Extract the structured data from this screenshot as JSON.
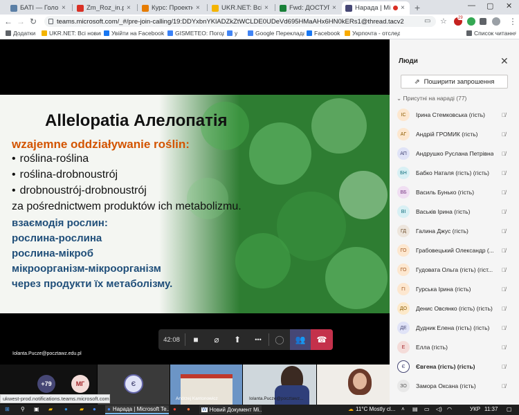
{
  "browser": {
    "tabs": [
      {
        "title": "БАТІ — Головні пр",
        "color": "#5b7fa6"
      },
      {
        "title": "Zm_Roz_in.pdf",
        "color": "#d93025"
      },
      {
        "title": "Курс: Проектний п",
        "color": "#e67c00"
      },
      {
        "title": "UKR.NET: Всі нови",
        "color": "#f4b400"
      },
      {
        "title": "Fwd: ДОСТУП ДО",
        "color": "#188038"
      },
      {
        "title": "Нарада | Micro",
        "color": "#464775"
      }
    ],
    "new_tab": "+",
    "url": "teams.microsoft.com/_#/pre-join-calling/19:DDYxbnYKlADZkZtWCLDE0UDeVd695HMaAHx6HN0kERs1@thread.tacv2",
    "bookmarks": [
      {
        "label": "Додатки",
        "color": "#5f6368"
      },
      {
        "label": "UKR.NET: Всі новин...",
        "color": "#f4b400"
      },
      {
        "label": "Увійти на Facebook...",
        "color": "#1877f2"
      },
      {
        "label": "GISMETEO: Погода...",
        "color": "#3b82f6"
      },
      {
        "label": "y",
        "color": "#4285f4"
      },
      {
        "label": "Google Перекладач",
        "color": "#4285f4"
      },
      {
        "label": "Facebook",
        "color": "#1877f2"
      },
      {
        "label": "Укрпочта - отслед...",
        "color": "#f9ab00"
      }
    ],
    "reading_list": "Список читання",
    "profile_badge": "29"
  },
  "slide": {
    "title": "Allelopatia Алелопатія",
    "subtitle": "wzajemne oddziaływanie roślin:",
    "bullets": [
      "roślina-roślina",
      "roślina-drobnoustrój",
      "drobnoustrój-drobnoustrój"
    ],
    "line_pl": "za pośrednictwem produktów ich metabolizmu.",
    "lines_ua": [
      "взаємодія рослин:",
      "рослина-рослина",
      "рослина-мікроб",
      "мікроорганізм-мікроорганізм",
      "через продукти їх метаболізму."
    ]
  },
  "presenter_email": "Iolanta.Pucze@pocztawz.edu.pl",
  "call": {
    "timer": "42:08",
    "more": "•••"
  },
  "strip": {
    "more_count": "+79",
    "avatar_mg": "МГ",
    "avatar_e": "Є",
    "tile1_label": "Andrzej Kantonowicz",
    "tile2_label": "Iolanta.Pucze@pocztawz..."
  },
  "status_bar": "ukwest-prod.notifications.teams.microsoft.com...",
  "panel": {
    "title": "Люди",
    "share_label": "Поширити запрошення",
    "section": "Присутні на нараді (77)",
    "people": [
      {
        "initials": "ІС",
        "name": "Ірина Стемковська (гість)",
        "bg": "#fde7cf",
        "fg": "#8a5a00",
        "bold": false
      },
      {
        "initials": "АГ",
        "name": "Андрій ГРОМИК (гість)",
        "bg": "#fde7cf",
        "fg": "#8a5a00",
        "bold": false
      },
      {
        "initials": "АП",
        "name": "Андрушко Руслана Петрівна",
        "bg": "#e0e3f7",
        "fg": "#464775",
        "bold": false
      },
      {
        "initials": "БН",
        "name": "Бабко Наталя (гість) (гість)",
        "bg": "#d8f0f4",
        "fg": "#0b6a79",
        "bold": false
      },
      {
        "initials": "ВБ",
        "name": "Василь Бунько (гість)",
        "bg": "#f0def2",
        "fg": "#7a3b85",
        "bold": false
      },
      {
        "initials": "ВІ",
        "name": "Васьків Ірина (гість)",
        "bg": "#d8f0f4",
        "fg": "#0b6a79",
        "bold": false
      },
      {
        "initials": "ГД",
        "name": "Галина Джус (гість)",
        "bg": "#ede5dc",
        "fg": "#6b4c2a",
        "bold": false
      },
      {
        "initials": "ГО",
        "name": "Грабовецький Олександр (...",
        "bg": "#fde7cf",
        "fg": "#a0521a",
        "bold": false
      },
      {
        "initials": "ГО",
        "name": "Гудовата Ольга (гість) (гіст...",
        "bg": "#fde7cf",
        "fg": "#a0521a",
        "bold": false
      },
      {
        "initials": "ГІ",
        "name": "Гурська Ірина (гість)",
        "bg": "#fde7cf",
        "fg": "#a0521a",
        "bold": false
      },
      {
        "initials": "ДО",
        "name": "Денис Овсянко (гість) (гість)",
        "bg": "#fde9c9",
        "fg": "#8a5a00",
        "bold": false
      },
      {
        "initials": "ДЕ",
        "name": "Дудник Елена (гість) (гість)",
        "bg": "#e0e3f7",
        "fg": "#464775",
        "bold": false
      },
      {
        "initials": "Е",
        "name": "Елла (гість)",
        "bg": "#f4dcd9",
        "fg": "#a4262c",
        "bold": false
      },
      {
        "initials": "Є",
        "name": "Євгена (гість) (гість)",
        "bg": "#ffffff",
        "fg": "#464775",
        "bold": true
      },
      {
        "initials": "ЗО",
        "name": "Замора Оксана (гість)",
        "bg": "#e8e8e8",
        "fg": "#555",
        "bold": false
      }
    ]
  },
  "taskbar": {
    "app1": "Нарада | Microsoft Te...",
    "app2": "Новий Документ Mi...",
    "weather": "11°C  Mostly cl...",
    "lang": "УКР",
    "time": "11:37"
  }
}
